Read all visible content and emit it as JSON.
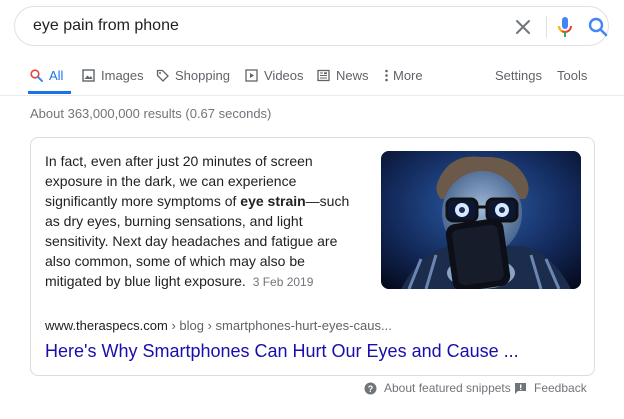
{
  "search": {
    "query": "eye pain from phone"
  },
  "tabs": [
    {
      "label": "All",
      "active": true
    },
    {
      "label": "Images"
    },
    {
      "label": "Shopping"
    },
    {
      "label": "Videos"
    },
    {
      "label": "News"
    },
    {
      "label": "More"
    }
  ],
  "tools": {
    "settings_label": "Settings",
    "tools_label": "Tools"
  },
  "result_stats": "About 363,000,000 results (0.67 seconds)",
  "snippet": {
    "text_before": "In fact, even after just 20 minutes of screen exposure in the dark, we can experience significantly more symptoms of ",
    "highlight": "eye strain",
    "text_after": "—such as dry eyes, burning sensations, and light sensitivity. Next day headaches and fatigue are also common, some of which may also be mitigated by blue light exposure.",
    "date": "3 Feb 2019",
    "source_domain": "www.theraspecs.com",
    "source_path": " › blog › smartphones-hurt-eyes-caus...",
    "title": "Here's Why Smartphones Can Hurt Our Eyes and Cause ..."
  },
  "footer": {
    "about_label": "About featured snippets",
    "feedback_label": "Feedback"
  },
  "colors": {
    "link_blue": "#1a0dab",
    "accent_blue": "#1a73e8",
    "muted_gray": "#70757a"
  }
}
